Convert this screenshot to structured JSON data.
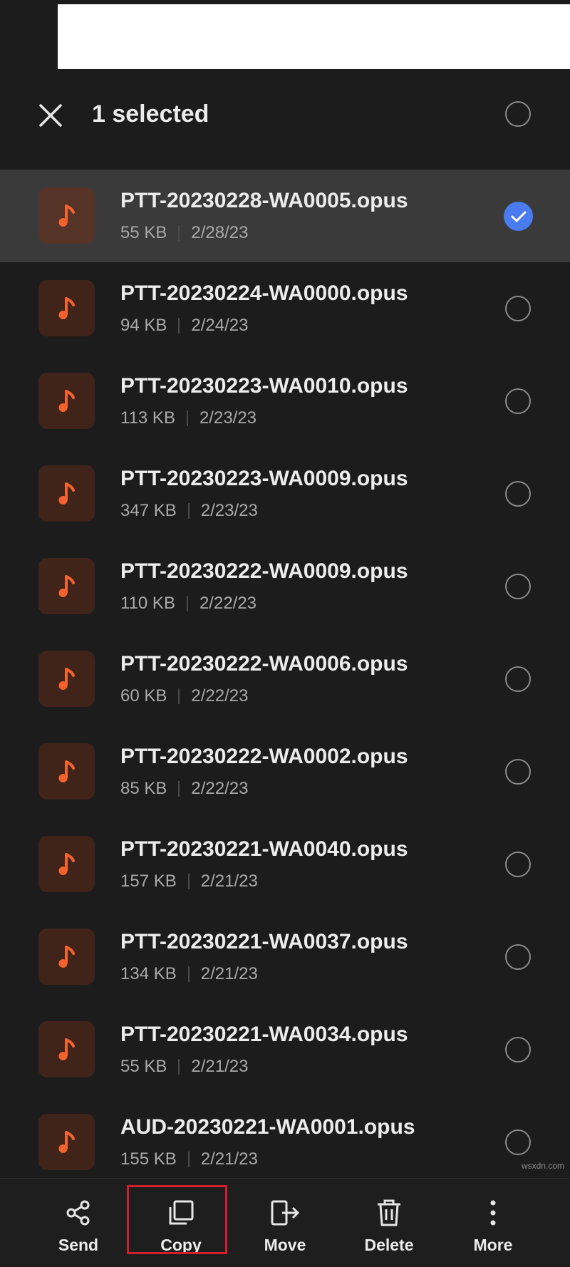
{
  "header": {
    "title": "1 selected"
  },
  "files": [
    {
      "name": "PTT-20230228-WA0005.opus",
      "size": "55 KB",
      "date": "2/28/23",
      "selected": true
    },
    {
      "name": "PTT-20230224-WA0000.opus",
      "size": "94 KB",
      "date": "2/24/23",
      "selected": false
    },
    {
      "name": "PTT-20230223-WA0010.opus",
      "size": "113 KB",
      "date": "2/23/23",
      "selected": false
    },
    {
      "name": "PTT-20230223-WA0009.opus",
      "size": "347 KB",
      "date": "2/23/23",
      "selected": false
    },
    {
      "name": "PTT-20230222-WA0009.opus",
      "size": "110 KB",
      "date": "2/22/23",
      "selected": false
    },
    {
      "name": "PTT-20230222-WA0006.opus",
      "size": "60 KB",
      "date": "2/22/23",
      "selected": false
    },
    {
      "name": "PTT-20230222-WA0002.opus",
      "size": "85 KB",
      "date": "2/22/23",
      "selected": false
    },
    {
      "name": "PTT-20230221-WA0040.opus",
      "size": "157 KB",
      "date": "2/21/23",
      "selected": false
    },
    {
      "name": "PTT-20230221-WA0037.opus",
      "size": "134 KB",
      "date": "2/21/23",
      "selected": false
    },
    {
      "name": "PTT-20230221-WA0034.opus",
      "size": "55 KB",
      "date": "2/21/23",
      "selected": false
    },
    {
      "name": "AUD-20230221-WA0001.opus",
      "size": "155 KB",
      "date": "2/21/23",
      "selected": false
    }
  ],
  "actions": {
    "send": "Send",
    "copy": "Copy",
    "move": "Move",
    "delete": "Delete",
    "more": "More"
  },
  "watermark": "wsxdn.com",
  "icons": {
    "file": "music-note-icon",
    "close": "close-icon",
    "checked": "check-icon"
  },
  "colors": {
    "background": "#1c1c1c",
    "selected_row": "#3a3a3a",
    "accent_check": "#4a7cf0",
    "music_note": "#f4632e",
    "highlight_box": "#d21f2b"
  }
}
